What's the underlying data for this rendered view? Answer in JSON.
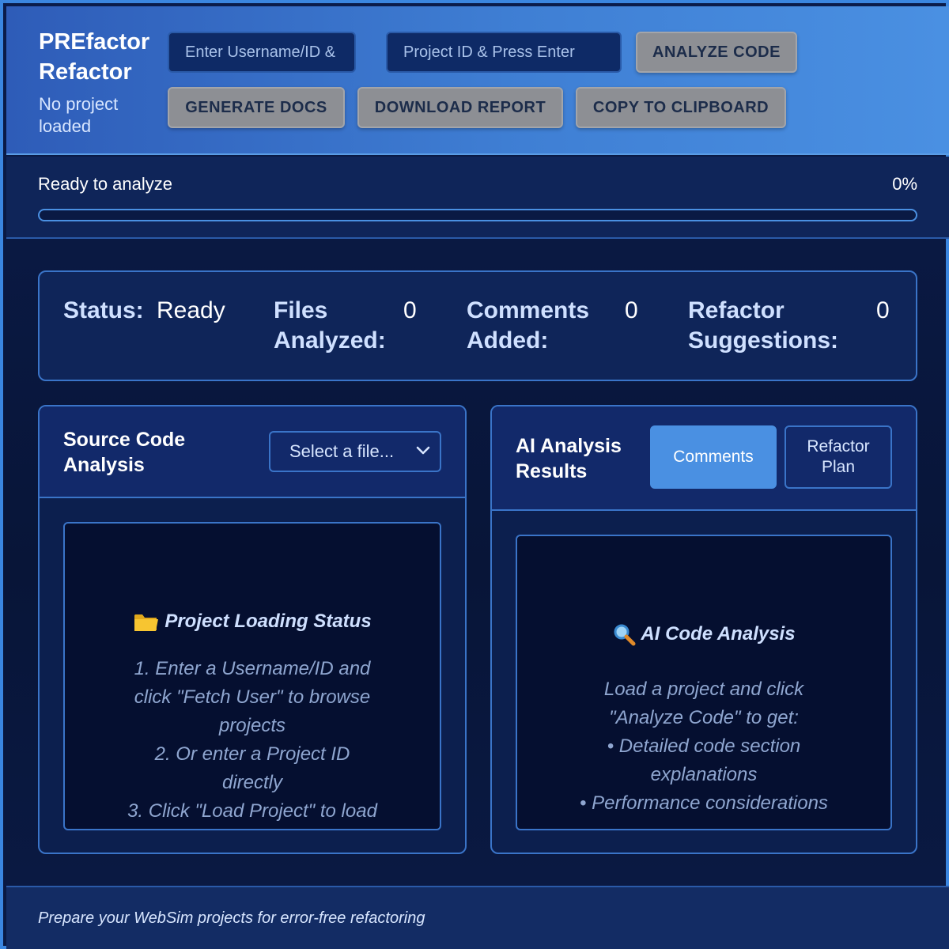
{
  "header": {
    "title": "PREfactor Refactor",
    "subtitle": "No project loaded",
    "username_placeholder": "Enter Username/ID &",
    "project_placeholder": "Project ID & Press Enter",
    "analyze_label": "ANALYZE CODE",
    "docs_label": "GENERATE DOCS",
    "download_label": "DOWNLOAD REPORT",
    "copy_label": "COPY TO CLIPBOARD"
  },
  "progress": {
    "label": "Ready to analyze",
    "percent_text": "0%",
    "value": 0
  },
  "stats": {
    "status_label": "Status:",
    "status_value": "Ready",
    "files_label": "Files Analyzed:",
    "files_value": "0",
    "comments_label": "Comments Added:",
    "comments_value": "0",
    "suggestions_label": "Refactor Suggestions:",
    "suggestions_value": "0"
  },
  "source_panel": {
    "title": "Source Code Analysis",
    "select_value": "Select a file...",
    "heading_icon": "folder-icon",
    "heading": "Project Loading Status",
    "lines": [
      "1. Enter a Username/ID and",
      "click \"Fetch User\" to browse",
      "projects",
      "2. Or enter a Project ID",
      "directly",
      "3. Click \"Load Project\" to load"
    ]
  },
  "analysis_panel": {
    "title": "AI Analysis Results",
    "tab_comments": "Comments",
    "tab_refactor": "Refactor Plan",
    "heading_icon": "magnifier-icon",
    "heading": "AI Code Analysis",
    "lines": [
      "Load a project and click",
      "\"Analyze Code\" to get:",
      "• Detailed code section",
      "explanations",
      "• Performance considerations"
    ]
  },
  "footer": {
    "text": "Prepare your WebSim projects for error-free refactoring"
  },
  "colors": {
    "accent": "#4a90e2",
    "button_gray": "#8d8f94",
    "panel_border": "#3a74c8",
    "background": "#0a1a44"
  }
}
